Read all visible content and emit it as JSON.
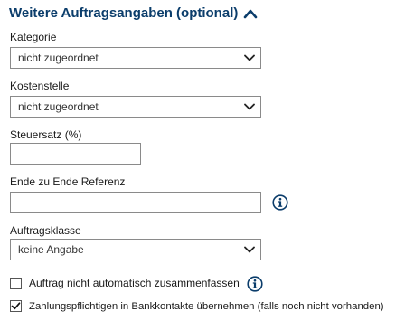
{
  "section": {
    "title": "Weitere Auftragsangaben (optional)",
    "expanded": true,
    "toggle_icon": "chevron-up-icon",
    "accent_color": "#0b3d6b"
  },
  "fields": {
    "kategorie": {
      "label": "Kategorie",
      "value": "nicht zugeordnet",
      "icon": "chevron-down-icon"
    },
    "kostenstelle": {
      "label": "Kostenstelle",
      "value": "nicht zugeordnet",
      "icon": "chevron-down-icon"
    },
    "steuersatz": {
      "label": "Steuersatz (%)",
      "value": "",
      "placeholder": ""
    },
    "referenz": {
      "label": "Ende zu Ende Referenz",
      "value": "",
      "placeholder": "",
      "info_icon": "info-icon"
    },
    "auftragsklasse": {
      "label": "Auftragsklasse",
      "value": "keine Angabe",
      "icon": "chevron-down-icon"
    }
  },
  "checkboxes": {
    "zusammenfassen": {
      "label": "Auftrag nicht automatisch zusammenfassen",
      "checked": false,
      "info_icon": "info-icon"
    },
    "bankkontakte": {
      "label": "Zahlungspflichtigen in Bankkontakte übernehmen (falls noch nicht vorhanden)",
      "checked": true
    }
  }
}
